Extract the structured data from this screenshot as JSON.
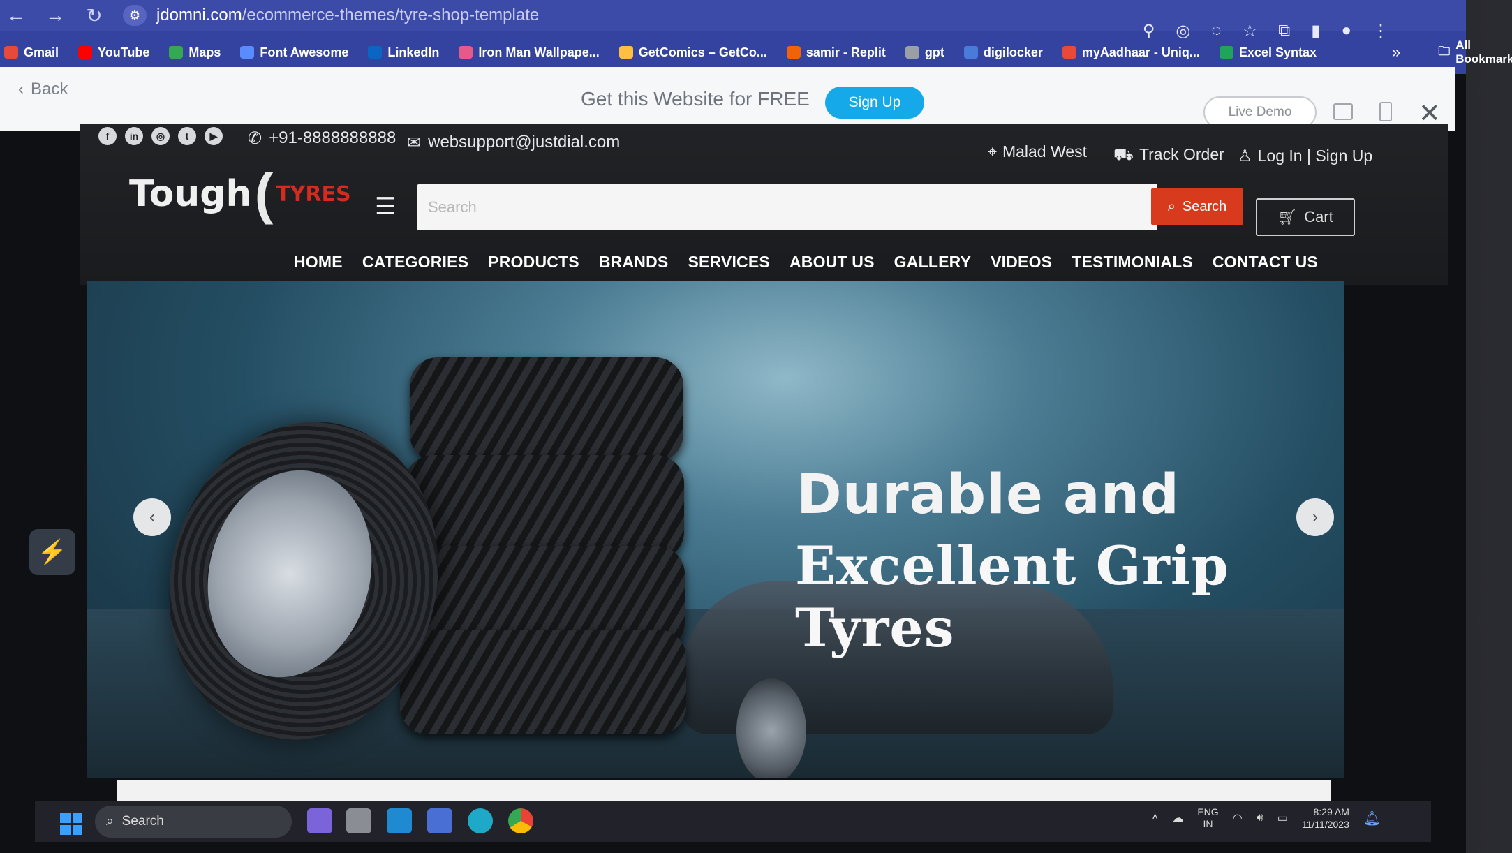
{
  "browser": {
    "address_host": "jdomni.com",
    "address_path": "/ecommerce-themes/tyre-shop-template",
    "bookmarks": [
      {
        "label": "Gmail",
        "color": "#e64a3b"
      },
      {
        "label": "YouTube",
        "color": "#ff0000"
      },
      {
        "label": "Maps",
        "color": "#34a853"
      },
      {
        "label": "Font Awesome",
        "color": "#5b8cff"
      },
      {
        "label": "LinkedIn",
        "color": "#0a66c2"
      },
      {
        "label": "Iron Man Wallpape...",
        "color": "#e65a8a"
      },
      {
        "label": "GetComics – GetCo...",
        "color": "#ffbf3f"
      },
      {
        "label": "samir - Replit",
        "color": "#f26207"
      },
      {
        "label": "gpt",
        "color": "#9aa0a6"
      },
      {
        "label": "digilocker",
        "color": "#4b7bd8"
      },
      {
        "label": "myAadhaar - Uniq...",
        "color": "#e8493b"
      },
      {
        "label": "Excel Syntax",
        "color": "#20a45b"
      }
    ],
    "bookmarks_more": "»",
    "all_bookmarks": "All Bookmarks"
  },
  "promo": {
    "back": "Back",
    "text": "Get this Website for FREE",
    "signup": "Sign Up",
    "live_demo": "Live Demo"
  },
  "site": {
    "phone": "+91-8888888888",
    "email": "websupport@justdial.com",
    "location": "Malad West",
    "track_order": "Track Order",
    "login": "Log In | Sign Up",
    "logo_brand": "Tough",
    "logo_tyres": "TYRES",
    "search_placeholder": "Search",
    "search_button": "Search",
    "cart": "Cart",
    "nav": [
      "HOME",
      "CATEGORIES",
      "PRODUCTS",
      "BRANDS",
      "SERVICES",
      "ABOUT US",
      "GALLERY",
      "VIDEOS",
      "TESTIMONIALS",
      "CONTACT US"
    ],
    "hero_line1": "Durable and",
    "hero_line2": "Excellent Grip Tyres"
  },
  "taskbar": {
    "search": "Search",
    "lang_1": "ENG",
    "lang_2": "IN",
    "time": "8:29 AM",
    "date": "11/11/2023"
  }
}
